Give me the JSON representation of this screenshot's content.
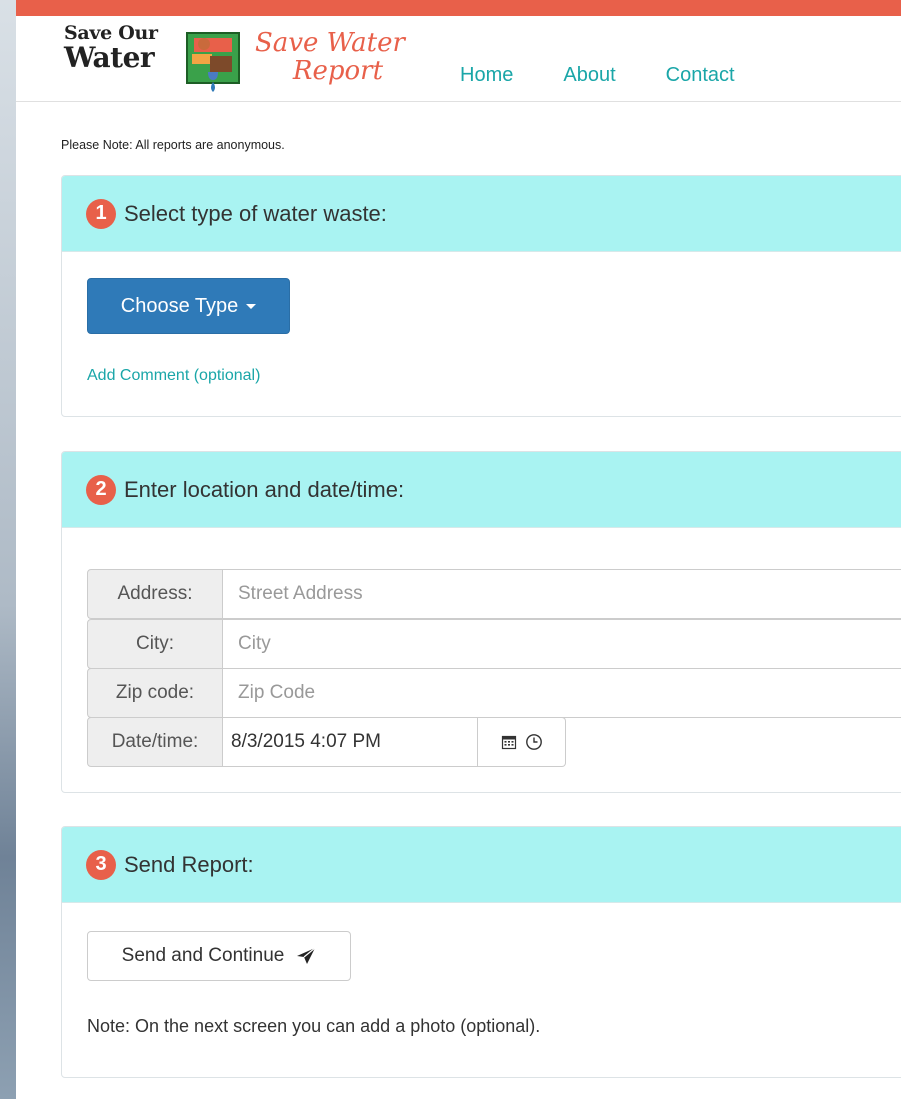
{
  "brand": {
    "line1": "Save Our",
    "line2": "Water",
    "script_line1": "Save Water",
    "script_line2": "Report"
  },
  "nav": {
    "home": "Home",
    "about": "About",
    "contact": "Contact"
  },
  "notice": "Please Note: All reports are anonymous.",
  "step1": {
    "number": "1",
    "title": "Select type of water waste:",
    "choose_label": "Choose Type",
    "comment_link": "Add Comment (optional)"
  },
  "step2": {
    "number": "2",
    "title": "Enter location and date/time:",
    "address_label": "Address:",
    "address_placeholder": "Street Address",
    "city_label": "City:",
    "city_placeholder": "City",
    "zip_label": "Zip code:",
    "zip_placeholder": "Zip Code",
    "datetime_label": "Date/time:",
    "datetime_value": "8/3/2015 4:07 PM",
    "calendar_icon": "calendar-icon",
    "clock_icon": "clock-icon"
  },
  "step3": {
    "number": "3",
    "title": "Send Report:",
    "send_label": "Send and Continue",
    "send_icon": "paper-plane-icon",
    "note": "Note: On the next screen you can add a photo (optional)."
  },
  "colors": {
    "accent": "#e8604a",
    "panel_heading": "#a9f3f2",
    "link": "#1aa6a8",
    "primary_button": "#2f7ab8"
  }
}
